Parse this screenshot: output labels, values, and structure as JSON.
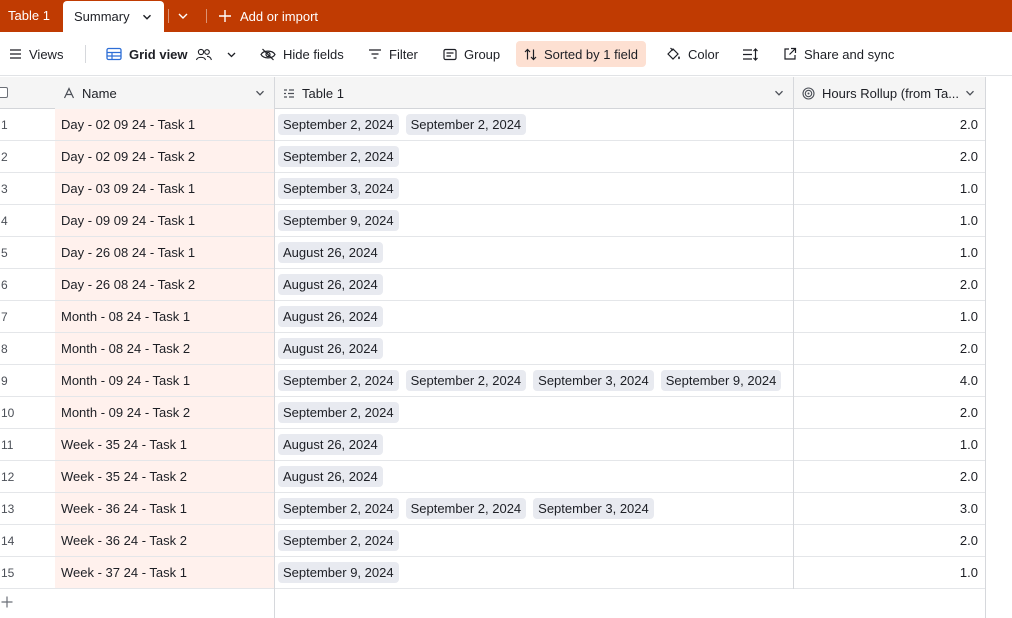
{
  "tabs": {
    "table1": "Table 1",
    "summary": "Summary",
    "add_import": "Add or import"
  },
  "toolbar": {
    "views": "Views",
    "grid_view": "Grid view",
    "hide_fields": "Hide fields",
    "filter": "Filter",
    "group": "Group",
    "sorted": "Sorted by 1 field",
    "color": "Color",
    "share_sync": "Share and sync"
  },
  "columns": {
    "name": "Name",
    "table1": "Table 1",
    "hours": "Hours Rollup (from Ta..."
  },
  "rows": [
    {
      "num": "1",
      "name": "Day - 02 09 24 - Task 1",
      "dates": [
        "September 2, 2024",
        "September 2, 2024"
      ],
      "hours": "2.0"
    },
    {
      "num": "2",
      "name": "Day - 02 09 24 - Task 2",
      "dates": [
        "September 2, 2024"
      ],
      "hours": "2.0"
    },
    {
      "num": "3",
      "name": "Day - 03 09 24 - Task 1",
      "dates": [
        "September 3, 2024"
      ],
      "hours": "1.0"
    },
    {
      "num": "4",
      "name": "Day - 09 09 24 - Task 1",
      "dates": [
        "September 9, 2024"
      ],
      "hours": "1.0"
    },
    {
      "num": "5",
      "name": "Day - 26 08 24 - Task 1",
      "dates": [
        "August 26, 2024"
      ],
      "hours": "1.0"
    },
    {
      "num": "6",
      "name": "Day - 26 08 24 - Task 2",
      "dates": [
        "August 26, 2024"
      ],
      "hours": "2.0"
    },
    {
      "num": "7",
      "name": "Month - 08 24 - Task 1",
      "dates": [
        "August 26, 2024"
      ],
      "hours": "1.0"
    },
    {
      "num": "8",
      "name": "Month - 08 24 - Task 2",
      "dates": [
        "August 26, 2024"
      ],
      "hours": "2.0"
    },
    {
      "num": "9",
      "name": "Month - 09 24 - Task 1",
      "dates": [
        "September 2, 2024",
        "September 2, 2024",
        "September 3, 2024",
        "September 9, 2024"
      ],
      "hours": "4.0"
    },
    {
      "num": "10",
      "name": "Month - 09 24 - Task 2",
      "dates": [
        "September 2, 2024"
      ],
      "hours": "2.0"
    },
    {
      "num": "11",
      "name": "Week - 35 24 - Task 1",
      "dates": [
        "August 26, 2024"
      ],
      "hours": "1.0"
    },
    {
      "num": "12",
      "name": "Week - 35 24 - Task 2",
      "dates": [
        "August 26, 2024"
      ],
      "hours": "2.0"
    },
    {
      "num": "13",
      "name": "Week - 36 24 - Task 1",
      "dates": [
        "September 2, 2024",
        "September 2, 2024",
        "September 3, 2024"
      ],
      "hours": "3.0"
    },
    {
      "num": "14",
      "name": "Week - 36 24 - Task 2",
      "dates": [
        "September 2, 2024"
      ],
      "hours": "2.0"
    },
    {
      "num": "15",
      "name": "Week - 37 24 - Task 1",
      "dates": [
        "September 9, 2024"
      ],
      "hours": "1.0"
    }
  ],
  "colors": {
    "header_bar": "#c03b02",
    "name_cell_bg": "#fff1ed",
    "chip_bg": "#e8eaf0",
    "sorted_bg": "#fde0d2"
  }
}
